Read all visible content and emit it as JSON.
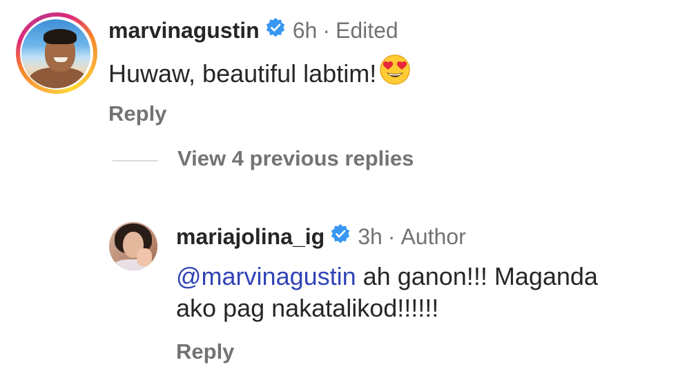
{
  "comments": [
    {
      "username": "marvinagustin",
      "verified_icon": "verified-badge-icon",
      "time": "6h",
      "separator": "·",
      "tag": "Edited",
      "text": "Huwaw, beautiful labtim!",
      "emoji": "heart-eyes-emoji",
      "reply_label": "Reply",
      "has_story_ring": true
    }
  ],
  "view_previous": {
    "label": "View 4 previous replies"
  },
  "replies": [
    {
      "username": "mariajolina_ig",
      "verified_icon": "verified-badge-icon",
      "time": "3h",
      "separator": "·",
      "tag": "Author",
      "mention": "@marvinagustin",
      "text_line1": " ah ganon!!! Maganda",
      "text_line2": "ako pag nakatalikod!!!!!!",
      "reply_label": "Reply"
    }
  ],
  "colors": {
    "text": "#262626",
    "secondary": "#737373",
    "mention": "#3143b5",
    "verified": "#3897f0",
    "divider": "#dbdbdb"
  }
}
